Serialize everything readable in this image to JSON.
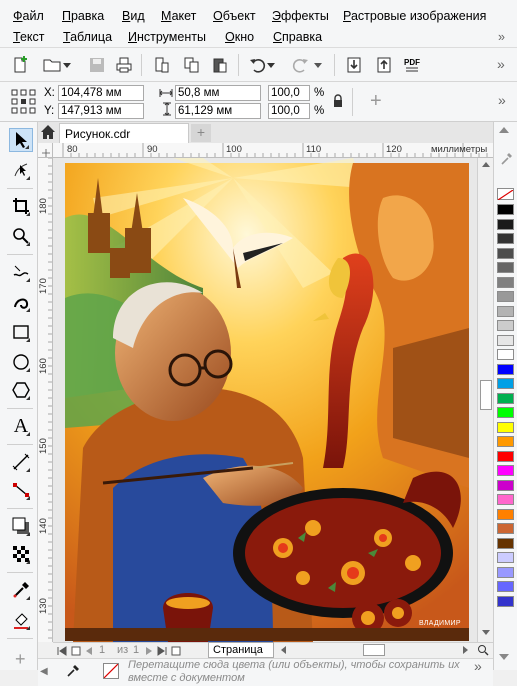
{
  "menu": {
    "row1": [
      "Файл",
      "Правка",
      "Вид",
      "Макет",
      "Объект",
      "Эффекты",
      "Растровые изображения"
    ],
    "row2": [
      "Текст",
      "Таблица",
      "Инструменты",
      "Окно",
      "Справка"
    ],
    "overflow": "»"
  },
  "toolbar": {
    "pdf_label": "PDF",
    "overflow": "»"
  },
  "properties": {
    "x_label": "X:",
    "x_value": "104,478 мм",
    "y_label": "Y:",
    "y_value": "147,913 мм",
    "width_value": "50,8 мм",
    "height_value": "61,129 мм",
    "scale_x": "100,0",
    "scale_y": "100,0",
    "percent": "%"
  },
  "tabs": {
    "document": "Рисунок.cdr",
    "add": "+"
  },
  "ruler": {
    "units": "миллиметры",
    "h_ticks": [
      "80",
      "90",
      "100",
      "110",
      "120"
    ],
    "v_ticks": [
      "180",
      "170",
      "160",
      "150",
      "140",
      "130"
    ]
  },
  "artwork": {
    "signature": "ВЛАДИМИР"
  },
  "page_nav": {
    "current": "1",
    "of_label": "из",
    "total": "1",
    "page_tab": "Страница"
  },
  "doc_palette": {
    "hint": "Перетащите сюда цвета (или объекты), чтобы сохранить их вместе с документом"
  },
  "colors": {
    "accent": "#1e6fd9",
    "palette": [
      "#ffffff",
      "#000000",
      "#1a1a1a",
      "#333333",
      "#4d4d4d",
      "#666666",
      "#808080",
      "#999999",
      "#b3b3b3",
      "#cccccc",
      "#e6e6e6",
      "#ffffff",
      "#0000ff",
      "#00a0e6",
      "#00b050",
      "#00ff00",
      "#ffff00",
      "#ff9900",
      "#ff0000",
      "#ff00ff",
      "#cc00cc",
      "#ff66cc",
      "#ff8000",
      "#cc6633",
      "#663300",
      "#ccccff",
      "#9999ff",
      "#6666ff",
      "#3333cc"
    ]
  }
}
